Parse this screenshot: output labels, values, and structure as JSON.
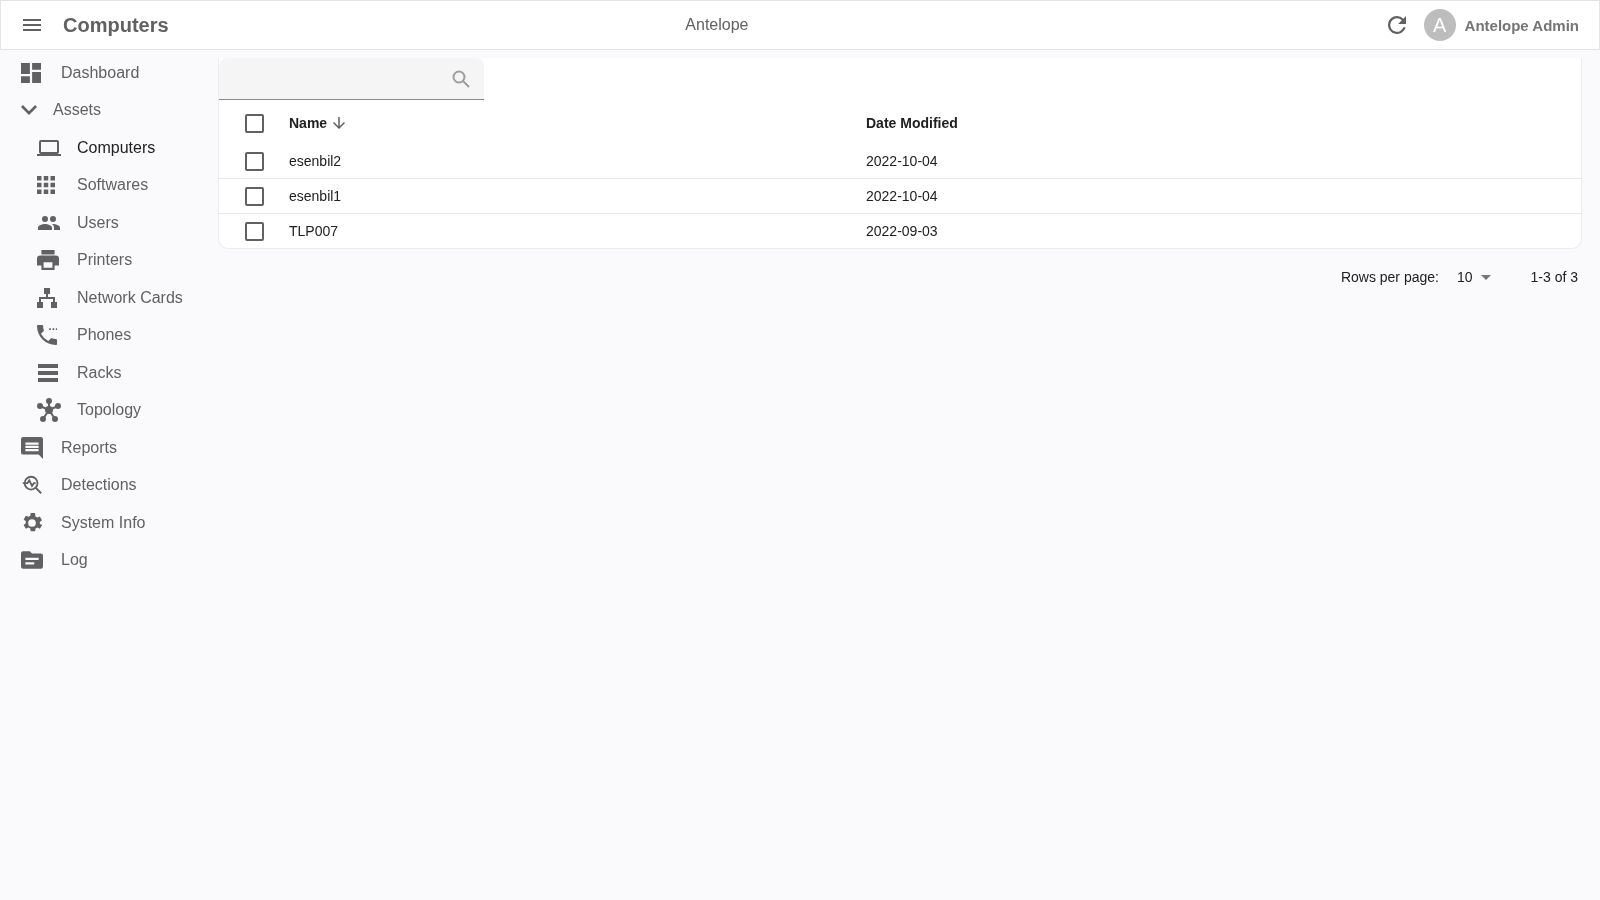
{
  "app_bar": {
    "title": "Computers",
    "center_title": "Antelope",
    "avatar_letter": "A",
    "user_name": "Antelope Admin"
  },
  "sidebar": {
    "items": [
      {
        "label": "Dashboard",
        "selected": false
      },
      {
        "label": "Assets",
        "selected": false,
        "expanded": true,
        "children": [
          {
            "label": "Computers",
            "selected": true
          },
          {
            "label": "Softwares",
            "selected": false
          },
          {
            "label": "Users",
            "selected": false
          },
          {
            "label": "Printers",
            "selected": false
          },
          {
            "label": "Network Cards",
            "selected": false
          },
          {
            "label": "Phones",
            "selected": false
          },
          {
            "label": "Racks",
            "selected": false
          },
          {
            "label": "Topology",
            "selected": false
          }
        ]
      },
      {
        "label": "Reports",
        "selected": false
      },
      {
        "label": "Detections",
        "selected": false
      },
      {
        "label": "System Info",
        "selected": false
      },
      {
        "label": "Log",
        "selected": false
      }
    ]
  },
  "table": {
    "columns": [
      "Name",
      "Date Modified"
    ],
    "all_checked": false,
    "rows": [
      {
        "name": "esenbil2",
        "date_modified": "2022-10-04",
        "checked": false
      },
      {
        "name": "esenbil1",
        "date_modified": "2022-10-04",
        "checked": false
      },
      {
        "name": "TLP007",
        "date_modified": "2022-09-03",
        "checked": false
      }
    ]
  },
  "pagination": {
    "rows_per_page_label": "Rows per page:",
    "rows_per_page": "10",
    "range": "1-3 of 3"
  }
}
